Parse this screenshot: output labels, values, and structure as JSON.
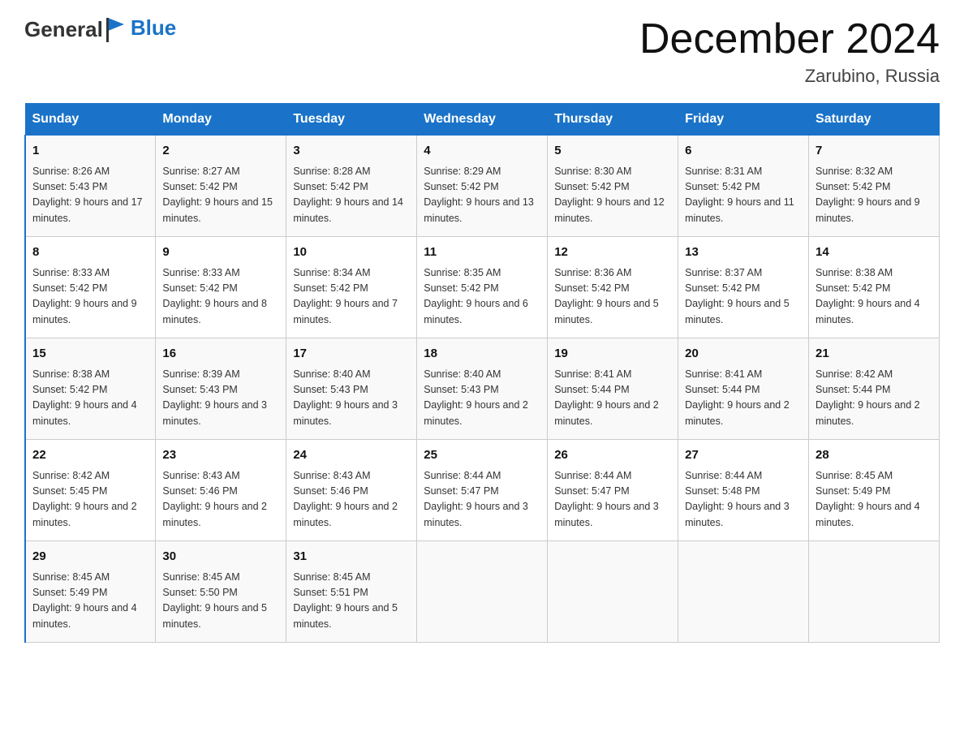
{
  "header": {
    "logo_general": "General",
    "logo_blue": "Blue",
    "month_title": "December 2024",
    "location": "Zarubino, Russia"
  },
  "days_of_week": [
    "Sunday",
    "Monday",
    "Tuesday",
    "Wednesday",
    "Thursday",
    "Friday",
    "Saturday"
  ],
  "weeks": [
    [
      {
        "day": "1",
        "sunrise": "8:26 AM",
        "sunset": "5:43 PM",
        "daylight": "9 hours and 17 minutes."
      },
      {
        "day": "2",
        "sunrise": "8:27 AM",
        "sunset": "5:42 PM",
        "daylight": "9 hours and 15 minutes."
      },
      {
        "day": "3",
        "sunrise": "8:28 AM",
        "sunset": "5:42 PM",
        "daylight": "9 hours and 14 minutes."
      },
      {
        "day": "4",
        "sunrise": "8:29 AM",
        "sunset": "5:42 PM",
        "daylight": "9 hours and 13 minutes."
      },
      {
        "day": "5",
        "sunrise": "8:30 AM",
        "sunset": "5:42 PM",
        "daylight": "9 hours and 12 minutes."
      },
      {
        "day": "6",
        "sunrise": "8:31 AM",
        "sunset": "5:42 PM",
        "daylight": "9 hours and 11 minutes."
      },
      {
        "day": "7",
        "sunrise": "8:32 AM",
        "sunset": "5:42 PM",
        "daylight": "9 hours and 9 minutes."
      }
    ],
    [
      {
        "day": "8",
        "sunrise": "8:33 AM",
        "sunset": "5:42 PM",
        "daylight": "9 hours and 9 minutes."
      },
      {
        "day": "9",
        "sunrise": "8:33 AM",
        "sunset": "5:42 PM",
        "daylight": "9 hours and 8 minutes."
      },
      {
        "day": "10",
        "sunrise": "8:34 AM",
        "sunset": "5:42 PM",
        "daylight": "9 hours and 7 minutes."
      },
      {
        "day": "11",
        "sunrise": "8:35 AM",
        "sunset": "5:42 PM",
        "daylight": "9 hours and 6 minutes."
      },
      {
        "day": "12",
        "sunrise": "8:36 AM",
        "sunset": "5:42 PM",
        "daylight": "9 hours and 5 minutes."
      },
      {
        "day": "13",
        "sunrise": "8:37 AM",
        "sunset": "5:42 PM",
        "daylight": "9 hours and 5 minutes."
      },
      {
        "day": "14",
        "sunrise": "8:38 AM",
        "sunset": "5:42 PM",
        "daylight": "9 hours and 4 minutes."
      }
    ],
    [
      {
        "day": "15",
        "sunrise": "8:38 AM",
        "sunset": "5:42 PM",
        "daylight": "9 hours and 4 minutes."
      },
      {
        "day": "16",
        "sunrise": "8:39 AM",
        "sunset": "5:43 PM",
        "daylight": "9 hours and 3 minutes."
      },
      {
        "day": "17",
        "sunrise": "8:40 AM",
        "sunset": "5:43 PM",
        "daylight": "9 hours and 3 minutes."
      },
      {
        "day": "18",
        "sunrise": "8:40 AM",
        "sunset": "5:43 PM",
        "daylight": "9 hours and 2 minutes."
      },
      {
        "day": "19",
        "sunrise": "8:41 AM",
        "sunset": "5:44 PM",
        "daylight": "9 hours and 2 minutes."
      },
      {
        "day": "20",
        "sunrise": "8:41 AM",
        "sunset": "5:44 PM",
        "daylight": "9 hours and 2 minutes."
      },
      {
        "day": "21",
        "sunrise": "8:42 AM",
        "sunset": "5:44 PM",
        "daylight": "9 hours and 2 minutes."
      }
    ],
    [
      {
        "day": "22",
        "sunrise": "8:42 AM",
        "sunset": "5:45 PM",
        "daylight": "9 hours and 2 minutes."
      },
      {
        "day": "23",
        "sunrise": "8:43 AM",
        "sunset": "5:46 PM",
        "daylight": "9 hours and 2 minutes."
      },
      {
        "day": "24",
        "sunrise": "8:43 AM",
        "sunset": "5:46 PM",
        "daylight": "9 hours and 2 minutes."
      },
      {
        "day": "25",
        "sunrise": "8:44 AM",
        "sunset": "5:47 PM",
        "daylight": "9 hours and 3 minutes."
      },
      {
        "day": "26",
        "sunrise": "8:44 AM",
        "sunset": "5:47 PM",
        "daylight": "9 hours and 3 minutes."
      },
      {
        "day": "27",
        "sunrise": "8:44 AM",
        "sunset": "5:48 PM",
        "daylight": "9 hours and 3 minutes."
      },
      {
        "day": "28",
        "sunrise": "8:45 AM",
        "sunset": "5:49 PM",
        "daylight": "9 hours and 4 minutes."
      }
    ],
    [
      {
        "day": "29",
        "sunrise": "8:45 AM",
        "sunset": "5:49 PM",
        "daylight": "9 hours and 4 minutes."
      },
      {
        "day": "30",
        "sunrise": "8:45 AM",
        "sunset": "5:50 PM",
        "daylight": "9 hours and 5 minutes."
      },
      {
        "day": "31",
        "sunrise": "8:45 AM",
        "sunset": "5:51 PM",
        "daylight": "9 hours and 5 minutes."
      },
      null,
      null,
      null,
      null
    ]
  ]
}
